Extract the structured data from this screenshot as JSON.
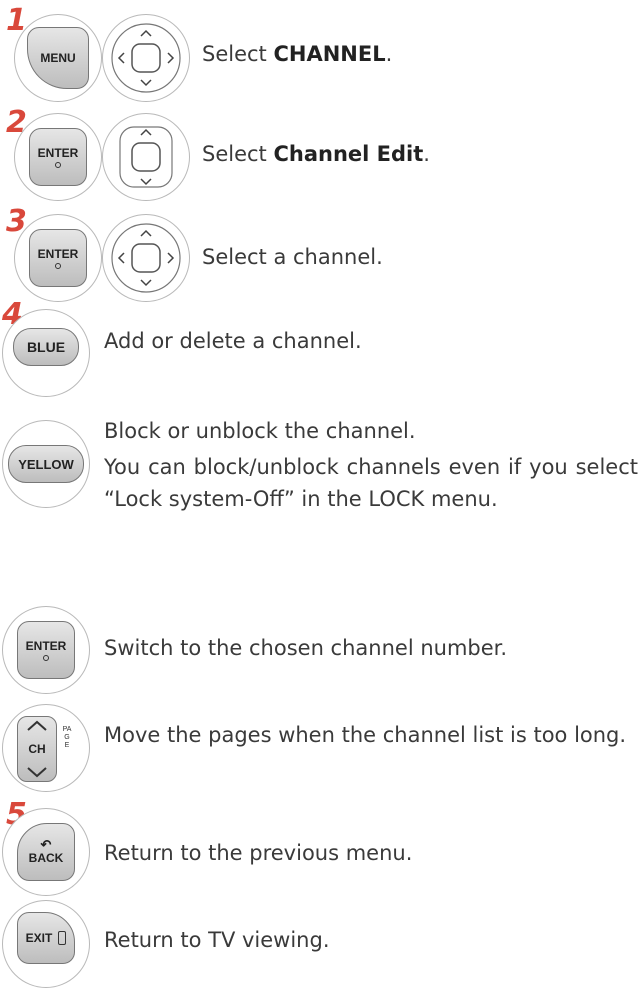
{
  "steps": {
    "s1": {
      "num": "1",
      "button": "MENU",
      "pre": "Select ",
      "bold": "CHANNEL",
      "post": "."
    },
    "s2": {
      "num": "2",
      "button": "ENTER",
      "pre": "Select ",
      "bold": "Channel Edit",
      "post": "."
    },
    "s3": {
      "num": "3",
      "button": "ENTER",
      "text": "Select a channel."
    },
    "s4": {
      "num": "4",
      "button": "BLUE",
      "text": "Add or delete a channel."
    },
    "s4b": {
      "button": "YELLOW",
      "line1": "Block or unblock the channel.",
      "line2": "You can block/unblock channels even if you select “Lock system-Off” in the LOCK menu."
    },
    "s4c": {
      "button": "ENTER",
      "text": "Switch to the chosen channel number."
    },
    "s4d": {
      "button": "CH",
      "side": "PAGE",
      "text": "Move the pages when the channel list is too long."
    },
    "s5": {
      "num": "5",
      "button": "BACK",
      "text": "Return to the previous menu."
    },
    "s5b": {
      "button": "EXIT",
      "text": "Return to TV viewing."
    }
  },
  "colors": {
    "step_number": "#d9483b",
    "text": "#3a3a3a"
  }
}
